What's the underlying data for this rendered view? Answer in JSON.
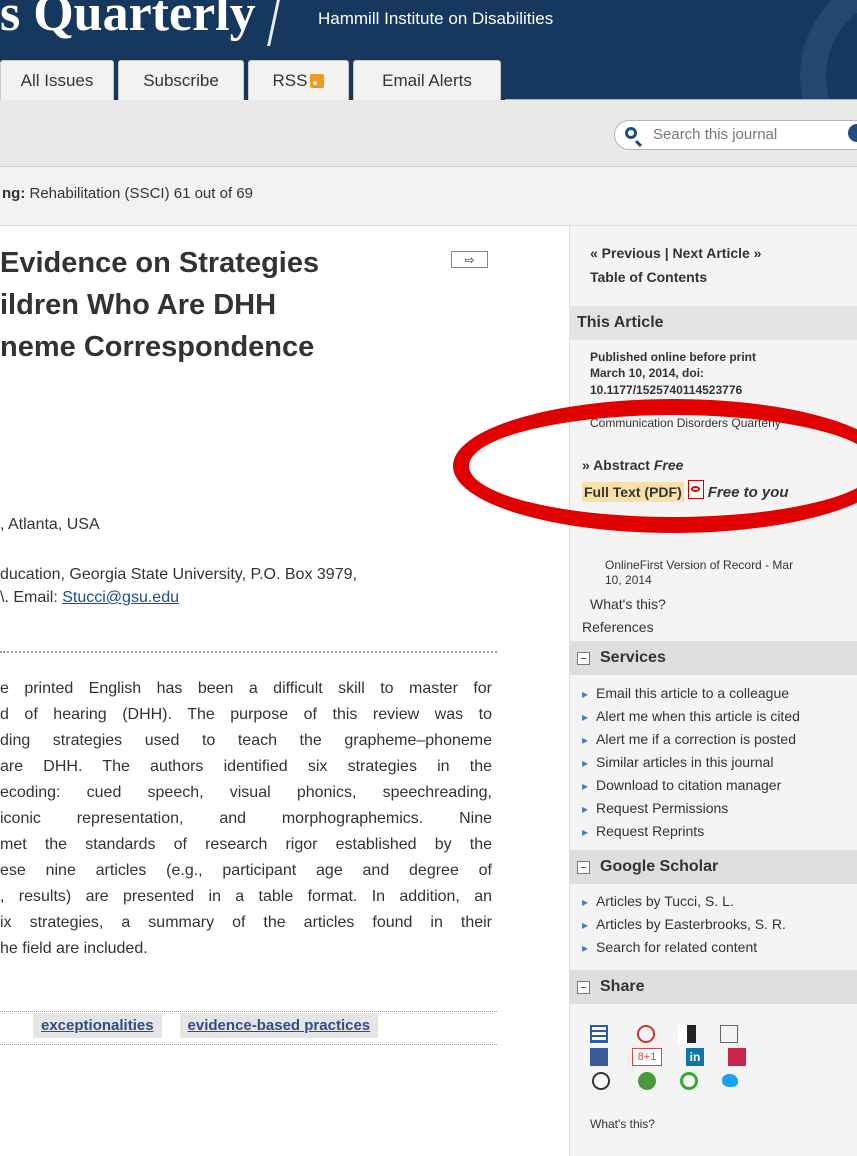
{
  "header": {
    "journal_title": "s Quarterly",
    "institute": "Hammill Institute on Disabilities"
  },
  "tabs": [
    {
      "label": "All Issues"
    },
    {
      "label": "Subscribe"
    },
    {
      "label": "RSS"
    },
    {
      "label": "Email Alerts"
    }
  ],
  "search": {
    "placeholder": "Search this journal"
  },
  "ranking": {
    "label": "ng:",
    "value": "Rehabilitation (SSCI) 61 out of 69"
  },
  "article": {
    "title_lines": [
      "Evidence on Strategies",
      "ildren Who Are DHH",
      "neme Correspondence"
    ],
    "affil_1": ", Atlanta, USA",
    "affil_2a": "ducation, Georgia State University, P.O. Box 3979,",
    "affil_2b": "\\. Email: ",
    "email": "Stucci@gsu.edu",
    "abstract_lines": [
      "e printed English has been a difficult skill to master for",
      "d of hearing (DHH). The purpose of this review was to",
      "ding strategies used to teach the grapheme–phoneme",
      "are DHH. The authors identified six strategies in the",
      "ecoding: cued speech, visual phonics, speechreading,",
      "iconic representation, and morphographemics. Nine",
      "met the standards of research rigor established by the",
      "ese nine articles (e.g., participant age and degree of",
      ", results) are presented in a table format. In addition, an",
      "ix strategies, a summary of the articles found in their",
      "he field are included."
    ],
    "keywords": [
      "exceptionalities",
      "evidence-based practices"
    ]
  },
  "sidebar": {
    "prev_next": "« Previous | Next Article »",
    "toc": "Table of Contents",
    "this_article": "This Article",
    "published_1": "Published online before print",
    "published_2": "March 10, 2014, doi:",
    "published_3": "10.1177/1525740114523776",
    "journal_ref": "Communication Disorders Quarterly",
    "abstract_link": "» Abstract",
    "abstract_free": "Free",
    "fulltext_link": "Full Text (PDF)",
    "fulltext_free": "Free to you",
    "online_first_1": "OnlineFirst Version of Record - Mar",
    "online_first_2": "10, 2014",
    "whats_this": "What's this?",
    "references": "References",
    "services_title": "Services",
    "services": [
      "Email this article to a colleague",
      "Alert me when this article is cited",
      "Alert me if a correction is posted",
      "Similar articles in this journal",
      "Download to citation manager",
      "Request Permissions",
      "Request Reprints"
    ],
    "scholar_title": "Google Scholar",
    "scholar": [
      "Articles by Tucci, S. L.",
      "Articles by Easterbrooks, S. R.",
      "Search for related content"
    ],
    "share_title": "Share",
    "share_whats_this": "What's this?",
    "share_gplus": "8+1",
    "share_linkedin": "in"
  },
  "colors": {
    "header_bg": "#16375e",
    "annotation_red": "#e00000",
    "link_blue": "#1a4b9b"
  }
}
